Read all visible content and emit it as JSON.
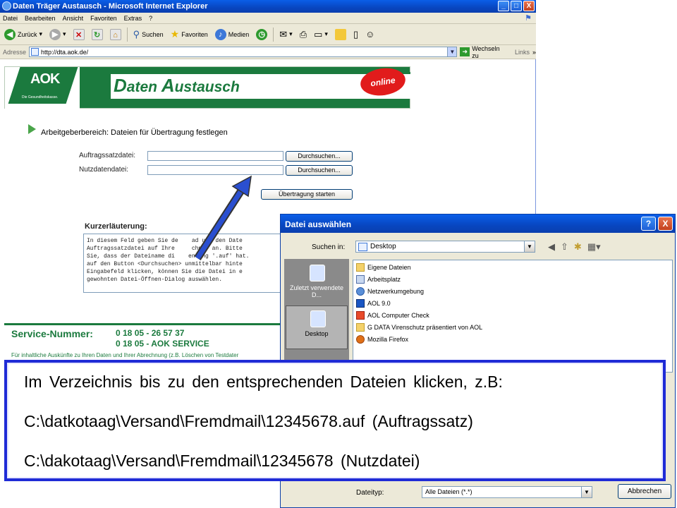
{
  "window": {
    "title": "Daten Träger Austausch - Microsoft Internet Explorer",
    "btn_min": "_",
    "btn_max": "□",
    "btn_close": "X"
  },
  "menubar": [
    "Datei",
    "Bearbeiten",
    "Ansicht",
    "Favoriten",
    "Extras",
    "?"
  ],
  "toolbar": {
    "back": "Zurück",
    "search": "Suchen",
    "favorites": "Favoriten",
    "media": "Medien"
  },
  "addressbar": {
    "label": "Adresse",
    "url": "http://dta.aok.de/",
    "go": "Wechseln zu",
    "links": "Links"
  },
  "banner": {
    "logo": "AOK",
    "logo_sub": "Die Gesundheitskasse.",
    "title_d": "D",
    "title_aten": "aten",
    "title_a": "A",
    "title_ustausch": "ustausch",
    "online": "online"
  },
  "form": {
    "section_title": "Arbeitgeberbereich: Dateien für Übertragung festlegen",
    "auftrag_label": "Auftragssatzdatei:",
    "nutzdaten_label": "Nutzdatendatei:",
    "browse": "Durchsuchen...",
    "start": "Übertragung starten",
    "kurz_title": "Kurzerläuterung:",
    "kurz_text": "In diesem Feld geben Sie de    ad und den Date\nAuftragssatzdatei auf Ihre     chner an. Bitte\nSie, dass der Dateiname di    endung '.auf' hat.\nauf den Button <Durchsuchen> unmittelbar hinte\nEingabefeld klicken, können Sie die Datei in e\ngewohnten Datei-Öffnen-Dialog auswählen."
  },
  "service": {
    "title": "Service-Nummer:",
    "num1": "0 18 05 - 26 57 37",
    "num2": "0 18 05 - AOK SERVICE",
    "small": "Für inhaltliche Auskünfte zu Ihren Daten und Ihrer Abrechnung (z.B. Löschen von Testdater"
  },
  "dialog": {
    "title": "Datei auswählen",
    "help": "?",
    "close": "X",
    "suchen_in": "Suchen in:",
    "folder": "Desktop",
    "places": [
      "Zuletzt verwendete D...",
      "Desktop"
    ],
    "files": [
      "Eigene Dateien",
      "Arbeitsplatz",
      "Netzwerkumgebung",
      "AOL 9.0",
      "AOL Computer Check",
      "G DATA Virenschutz präsentiert von AOL",
      "Mozilla Firefox"
    ],
    "dateityp": "Dateityp:",
    "dateityp_value": "Alle Dateien (*.*)",
    "abbrechen": "Abbrechen"
  },
  "note": {
    "line1": "Im Verzeichnis bis zu den entsprechenden Dateien klicken, z.B:",
    "line2": "C:\\datkotaag\\Versand\\Fremdmail\\12345678.auf  (Auftragssatz)",
    "line3": "C:\\dakotaag\\Versand\\Fremdmail\\12345678  (Nutzdatei)"
  }
}
